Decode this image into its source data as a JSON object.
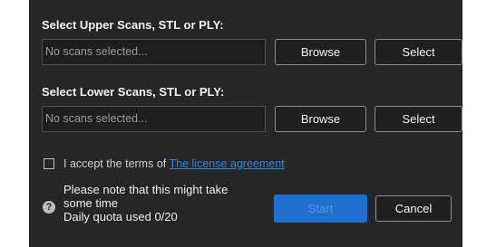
{
  "upper": {
    "label": "Select Upper Scans, STL or PLY:",
    "field_text": "No scans selected...",
    "browse_label": "Browse",
    "select_label": "Select"
  },
  "lower": {
    "label": "Select Lower Scans, STL or PLY:",
    "field_text": "No scans selected...",
    "browse_label": "Browse",
    "select_label": "Select"
  },
  "terms": {
    "checked": false,
    "text": "I accept the terms of",
    "link_text": "The license agreement"
  },
  "note": {
    "help_icon_glyph": "?",
    "line1": "Please note that this might take",
    "line2": "some time",
    "line3": "Daily quota used 0/20"
  },
  "actions": {
    "start_label": "Start",
    "cancel_label": "Cancel",
    "start_enabled": false
  },
  "colors": {
    "panel_background": "#262626",
    "accent_blue": "#1f6fd0",
    "link_blue": "#2f86e0"
  }
}
